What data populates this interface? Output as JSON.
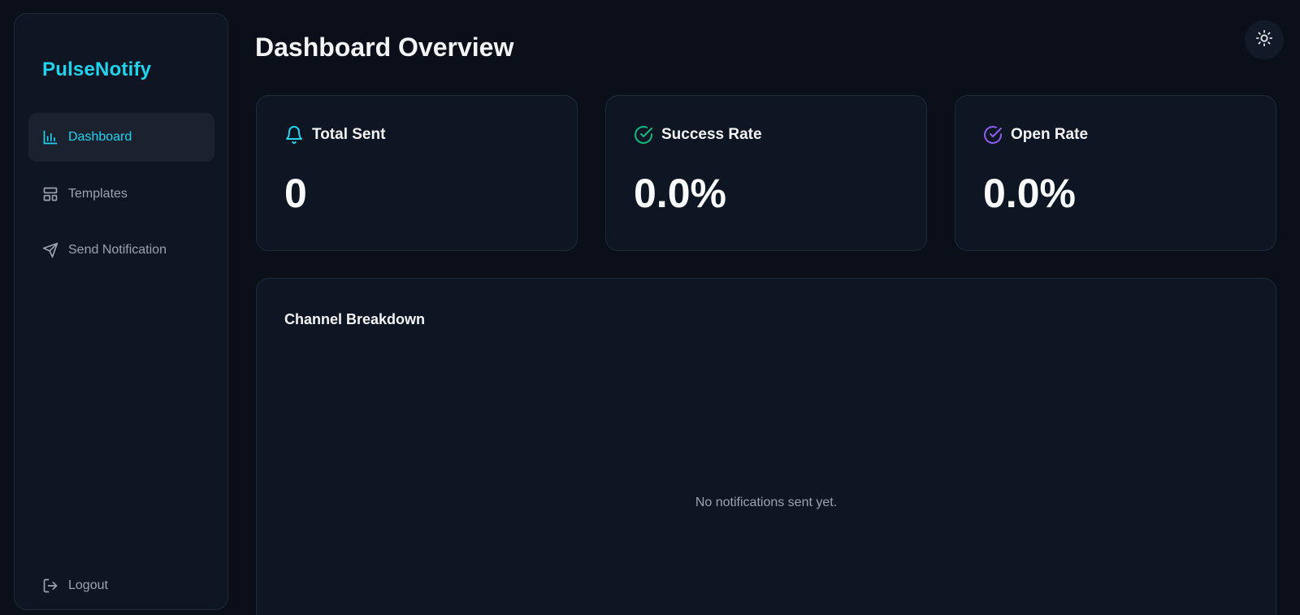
{
  "brand": {
    "name": "PulseNotify",
    "color": "#22d3ee"
  },
  "sidebar": {
    "items": [
      {
        "label": "Dashboard",
        "icon": "bar-chart-icon",
        "active": true
      },
      {
        "label": "Templates",
        "icon": "layout-icon",
        "active": false
      },
      {
        "label": "Send Notification",
        "icon": "send-icon",
        "active": false
      }
    ],
    "logout": {
      "label": "Logout",
      "icon": "logout-icon"
    }
  },
  "header": {
    "title": "Dashboard Overview",
    "theme_toggle_icon": "sun-icon"
  },
  "stats": [
    {
      "label": "Total Sent",
      "value": "0",
      "icon": "bell-icon",
      "color": "#22d3ee"
    },
    {
      "label": "Success Rate",
      "value": "0.0%",
      "icon": "check-circle-icon",
      "color": "#10b981"
    },
    {
      "label": "Open Rate",
      "value": "0.0%",
      "icon": "check-circle-icon",
      "color": "#8b5cf6"
    }
  ],
  "channel_breakdown": {
    "title": "Channel Breakdown",
    "empty_message": "No notifications sent yet."
  }
}
